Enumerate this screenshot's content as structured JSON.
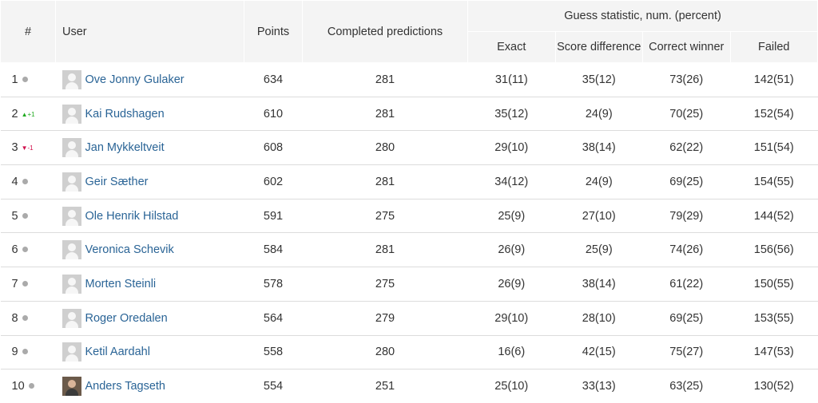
{
  "headers": {
    "rank": "#",
    "user": "User",
    "points": "Points",
    "completed": "Completed predictions",
    "guess_group": "Guess statistic, num. (percent)",
    "exact": "Exact",
    "score_difference": "Score difference",
    "correct_winner": "Correct winner",
    "failed": "Failed"
  },
  "rows": [
    {
      "rank": "1",
      "trend": "dot",
      "trend_text": "",
      "name": "Ove Jonny Gulaker",
      "points": "634",
      "completed": "281",
      "exact": "31(11)",
      "score_difference": "35(12)",
      "correct_winner": "73(26)",
      "failed": "142(51)",
      "avatar": "placeholder"
    },
    {
      "rank": "2",
      "trend": "up",
      "trend_text": "▲+1",
      "name": "Kai Rudshagen",
      "points": "610",
      "completed": "281",
      "exact": "35(12)",
      "score_difference": "24(9)",
      "correct_winner": "70(25)",
      "failed": "152(54)",
      "avatar": "placeholder"
    },
    {
      "rank": "3",
      "trend": "down",
      "trend_text": "▼-1",
      "name": "Jan Mykkeltveit",
      "points": "608",
      "completed": "280",
      "exact": "29(10)",
      "score_difference": "38(14)",
      "correct_winner": "62(22)",
      "failed": "151(54)",
      "avatar": "placeholder"
    },
    {
      "rank": "4",
      "trend": "dot",
      "trend_text": "",
      "name": "Geir Sæther",
      "points": "602",
      "completed": "281",
      "exact": "34(12)",
      "score_difference": "24(9)",
      "correct_winner": "69(25)",
      "failed": "154(55)",
      "avatar": "placeholder"
    },
    {
      "rank": "5",
      "trend": "dot",
      "trend_text": "",
      "name": "Ole Henrik Hilstad",
      "points": "591",
      "completed": "275",
      "exact": "25(9)",
      "score_difference": "27(10)",
      "correct_winner": "79(29)",
      "failed": "144(52)",
      "avatar": "placeholder"
    },
    {
      "rank": "6",
      "trend": "dot",
      "trend_text": "",
      "name": "Veronica Schevik",
      "points": "584",
      "completed": "281",
      "exact": "26(9)",
      "score_difference": "25(9)",
      "correct_winner": "74(26)",
      "failed": "156(56)",
      "avatar": "placeholder"
    },
    {
      "rank": "7",
      "trend": "dot",
      "trend_text": "",
      "name": "Morten Steinli",
      "points": "578",
      "completed": "275",
      "exact": "26(9)",
      "score_difference": "38(14)",
      "correct_winner": "61(22)",
      "failed": "150(55)",
      "avatar": "placeholder"
    },
    {
      "rank": "8",
      "trend": "dot",
      "trend_text": "",
      "name": "Roger Oredalen",
      "points": "564",
      "completed": "279",
      "exact": "29(10)",
      "score_difference": "28(10)",
      "correct_winner": "69(25)",
      "failed": "153(55)",
      "avatar": "placeholder"
    },
    {
      "rank": "9",
      "trend": "dot",
      "trend_text": "",
      "name": "Ketil Aardahl",
      "points": "558",
      "completed": "280",
      "exact": "16(6)",
      "score_difference": "42(15)",
      "correct_winner": "75(27)",
      "failed": "147(53)",
      "avatar": "placeholder"
    },
    {
      "rank": "10",
      "trend": "dot",
      "trend_text": "",
      "name": "Anders Tagseth",
      "points": "554",
      "completed": "251",
      "exact": "25(10)",
      "score_difference": "33(13)",
      "correct_winner": "63(25)",
      "failed": "130(52)",
      "avatar": "photo"
    }
  ]
}
